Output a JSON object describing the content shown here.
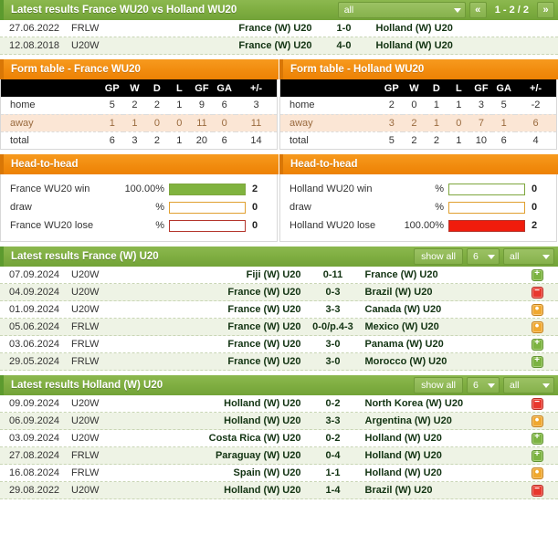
{
  "h2h_header": {
    "title": "Latest results France WU20 vs Holland WU20",
    "filter_value": "all",
    "prev_label": "«",
    "next_label": "»",
    "pager_text": "1 - 2 / 2"
  },
  "h2h_matches": [
    {
      "date": "27.06.2022",
      "league": "FRLW",
      "home": "France (W) U20",
      "score": "1-0",
      "away": "Holland (W) U20"
    },
    {
      "date": "12.08.2018",
      "league": "U20W",
      "home": "France (W) U20",
      "score": "4-0",
      "away": "Holland (W) U20"
    }
  ],
  "form_tables": [
    {
      "title": "Form table - France WU20",
      "columns": [
        "",
        "GP",
        "W",
        "D",
        "L",
        "GF",
        "GA",
        "+/-"
      ],
      "rows": [
        {
          "label": "home",
          "values": [
            "5",
            "2",
            "2",
            "1",
            "9",
            "6",
            "3"
          ]
        },
        {
          "label": "away",
          "values": [
            "1",
            "1",
            "0",
            "0",
            "11",
            "0",
            "11"
          ]
        },
        {
          "label": "total",
          "values": [
            "6",
            "3",
            "2",
            "1",
            "20",
            "6",
            "14"
          ]
        }
      ]
    },
    {
      "title": "Form table - Holland WU20",
      "columns": [
        "",
        "GP",
        "W",
        "D",
        "L",
        "GF",
        "GA",
        "+/-"
      ],
      "rows": [
        {
          "label": "home",
          "values": [
            "2",
            "0",
            "1",
            "1",
            "3",
            "5",
            "-2"
          ]
        },
        {
          "label": "away",
          "values": [
            "3",
            "2",
            "1",
            "0",
            "7",
            "1",
            "6"
          ]
        },
        {
          "label": "total",
          "values": [
            "5",
            "2",
            "2",
            "1",
            "10",
            "6",
            "4"
          ]
        }
      ]
    }
  ],
  "head_to_head": [
    {
      "title": "Head-to-head",
      "rows": [
        {
          "label": "France WU20 win",
          "pct": "100.00%",
          "pct_value": 100,
          "count": "2",
          "kind": "win"
        },
        {
          "label": "draw",
          "pct": "%",
          "pct_value": 0,
          "count": "0",
          "kind": "draw"
        },
        {
          "label": "France WU20 lose",
          "pct": "%",
          "pct_value": 0,
          "count": "0",
          "kind": "lose"
        }
      ]
    },
    {
      "title": "Head-to-head",
      "rows": [
        {
          "label": "Holland WU20 win",
          "pct": "%",
          "pct_value": 0,
          "count": "0",
          "kind": "win"
        },
        {
          "label": "draw",
          "pct": "%",
          "pct_value": 0,
          "count": "0",
          "kind": "draw"
        },
        {
          "label": "Holland WU20 lose",
          "pct": "100.00%",
          "pct_value": 100,
          "count": "2",
          "kind": "lose"
        }
      ]
    }
  ],
  "latest_france": {
    "title": "Latest results France (W) U20",
    "show_all_label": "show all",
    "count_value": "6",
    "filter_value": "all",
    "matches": [
      {
        "date": "07.09.2024",
        "league": "U20W",
        "home": "Fiji (W) U20",
        "score": "0-11",
        "away": "France (W) U20",
        "result": "win"
      },
      {
        "date": "04.09.2024",
        "league": "U20W",
        "home": "France (W) U20",
        "score": "0-3",
        "away": "Brazil (W) U20",
        "result": "lose"
      },
      {
        "date": "01.09.2024",
        "league": "U20W",
        "home": "France (W) U20",
        "score": "3-3",
        "away": "Canada (W) U20",
        "result": "draw"
      },
      {
        "date": "05.06.2024",
        "league": "FRLW",
        "home": "France (W) U20",
        "score": "0-0/p.4-3",
        "away": "Mexico (W) U20",
        "result": "draw"
      },
      {
        "date": "03.06.2024",
        "league": "FRLW",
        "home": "France (W) U20",
        "score": "3-0",
        "away": "Panama (W) U20",
        "result": "win"
      },
      {
        "date": "29.05.2024",
        "league": "FRLW",
        "home": "France (W) U20",
        "score": "3-0",
        "away": "Morocco (W) U20",
        "result": "win"
      }
    ]
  },
  "latest_holland": {
    "title": "Latest results Holland (W) U20",
    "show_all_label": "show all",
    "count_value": "6",
    "filter_value": "all",
    "matches": [
      {
        "date": "09.09.2024",
        "league": "U20W",
        "home": "Holland (W) U20",
        "score": "0-2",
        "away": "North Korea (W) U20",
        "result": "lose"
      },
      {
        "date": "06.09.2024",
        "league": "U20W",
        "home": "Holland (W) U20",
        "score": "3-3",
        "away": "Argentina (W) U20",
        "result": "draw"
      },
      {
        "date": "03.09.2024",
        "league": "U20W",
        "home": "Costa Rica (W) U20",
        "score": "0-2",
        "away": "Holland (W) U20",
        "result": "win"
      },
      {
        "date": "27.08.2024",
        "league": "FRLW",
        "home": "Paraguay (W) U20",
        "score": "0-4",
        "away": "Holland (W) U20",
        "result": "win"
      },
      {
        "date": "16.08.2024",
        "league": "FRLW",
        "home": "Spain (W) U20",
        "score": "1-1",
        "away": "Holland (W) U20",
        "result": "draw"
      },
      {
        "date": "29.08.2022",
        "league": "U20W",
        "home": "Holland (W) U20",
        "score": "1-4",
        "away": "Brazil (W) U20",
        "result": "lose"
      }
    ]
  },
  "icons": {
    "win": "+",
    "lose": "−",
    "draw": "•",
    "chevron_down": "chevron-down-icon"
  },
  "colors": {
    "green_header": "#7fae41",
    "orange_header": "#f28d10",
    "win": "#7cb342",
    "lose": "#e8382e",
    "draw": "#f0a830",
    "alt_row": "#eef3e5",
    "form_alt_row": "#fbe6d5"
  }
}
